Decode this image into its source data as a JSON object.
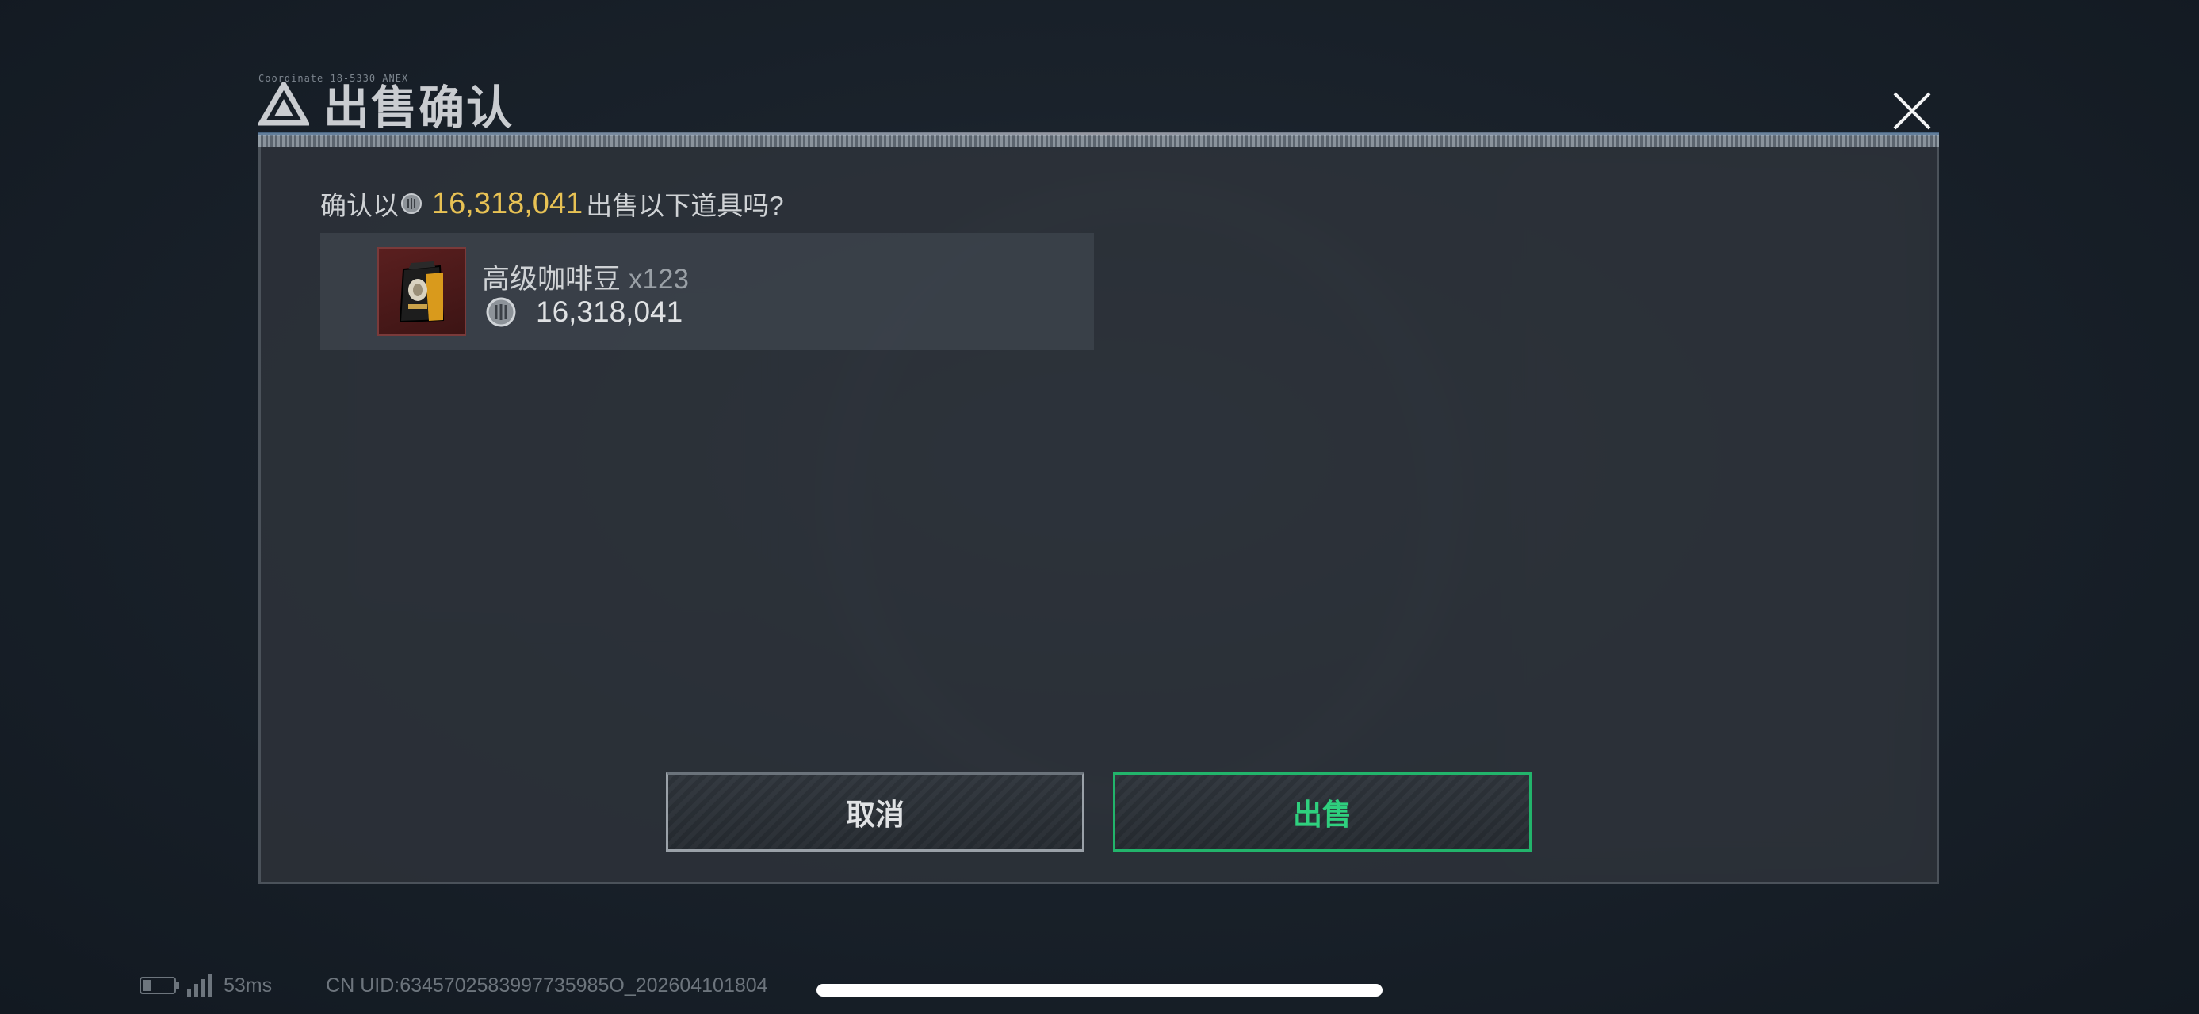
{
  "dialog": {
    "title": "出售确认",
    "header_tag": "Coordinate 18-5330 ANEX"
  },
  "confirm": {
    "prefix": "确认以",
    "amount": "16,318,041",
    "suffix": "出售以下道具吗?"
  },
  "item": {
    "name": "高级咖啡豆",
    "quantity": "x123",
    "price": "16,318,041",
    "icon": "coffee-bean-bag-icon"
  },
  "buttons": {
    "cancel_label": "取消",
    "sell_label": "出售"
  },
  "status": {
    "latency": "53ms",
    "uid": "CN UID:6345702583997735985O_202604101804",
    "battery_level": 0.3
  },
  "colors": {
    "accent_green": "#2fd07e",
    "amount_yellow": "#e8c254",
    "item_rarity": "#5a1f1f"
  }
}
